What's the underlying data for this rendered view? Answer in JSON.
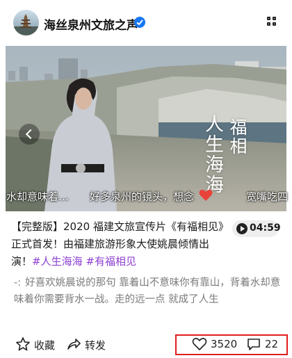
{
  "account": {
    "name": "海丝泉州文旅之声",
    "verified_icon": "verified-badge-icon",
    "more_icon": "more-grid-icon"
  },
  "media": {
    "vertical_text_right": "福相",
    "vertical_text_left": "人生海海",
    "subtitle_left": "水却意味着…",
    "subtitle_center": "好多泉州的镜头，想念",
    "subtitle_right": "宽嘴吃四",
    "heart_emoji": "red-heart-icon",
    "prev_icon": "chevron-left-icon"
  },
  "video": {
    "title_prefix": "【完整版】2020 福建文旅宣传片《有福相见》正式首发！由福建旅游形象大使姚晨倾情出演！",
    "hashtag_1": "#人生海海",
    "hashtag_2": "#有福相见",
    "duration": "04:59"
  },
  "comment": {
    "label": "-:",
    "text": "好喜欢姚晨说的那句 靠着山不意味你有靠山，背着水却意味着你需要背水一战。走的远一点 就成了人生"
  },
  "actions": {
    "collect_label": "收藏",
    "share_label": "转发",
    "like_count": "3520",
    "comment_count": "22"
  },
  "colors": {
    "hashtag": "#8d3fd2",
    "verified": "#1877f2",
    "highlight": "#e01e1e"
  }
}
